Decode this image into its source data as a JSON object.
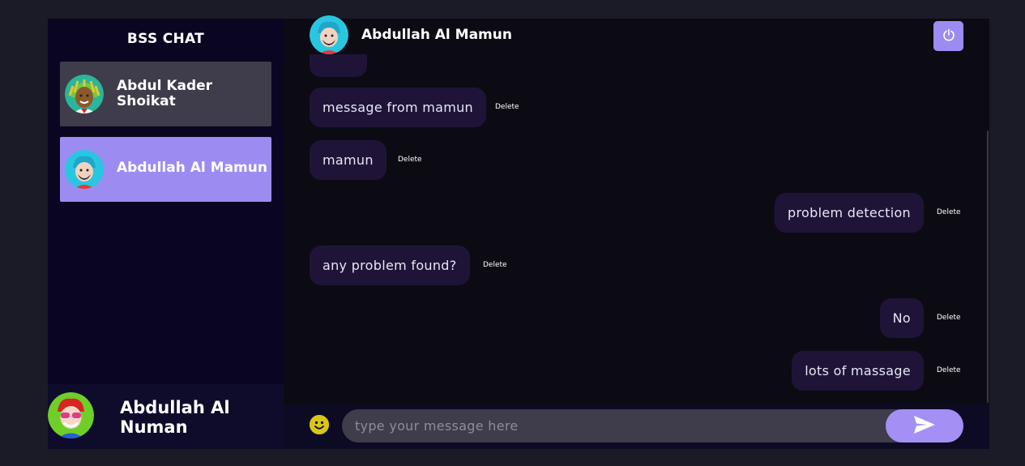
{
  "sidebar": {
    "brand": "BSS CHAT",
    "contacts": [
      {
        "name": "Abdul Kader Shoikat",
        "avatar_icon": "avatar-dreadlocks-icon",
        "active": false
      },
      {
        "name": "Abdullah Al Mamun",
        "avatar_icon": "avatar-blue-hair-icon",
        "active": true
      }
    ],
    "current_user": {
      "name": "Abdullah Al Numan",
      "avatar_icon": "avatar-red-hair-icon"
    }
  },
  "chat": {
    "header": {
      "title": "Abdullah Al Mamun",
      "avatar_icon": "avatar-blue-hair-icon",
      "power_icon": "power-icon"
    },
    "delete_label": "Delete",
    "messages": [
      {
        "text": "message from mamun",
        "side": "left"
      },
      {
        "text": "mamun",
        "side": "left"
      },
      {
        "text": "problem detection",
        "side": "right"
      },
      {
        "text": "any problem found?",
        "side": "left"
      },
      {
        "text": "No",
        "side": "right"
      },
      {
        "text": "lots of massage",
        "side": "right"
      }
    ],
    "composer": {
      "placeholder": "type your message here",
      "value": "",
      "emoji_icon": "smiley-icon",
      "send_icon": "send-icon"
    }
  },
  "colors": {
    "accent": "#9c8cf2",
    "bubble": "#1f1438",
    "sidebar_bg": "#0a0622",
    "chat_bg": "#0c0b14",
    "input_bg": "#3f3c4b"
  }
}
